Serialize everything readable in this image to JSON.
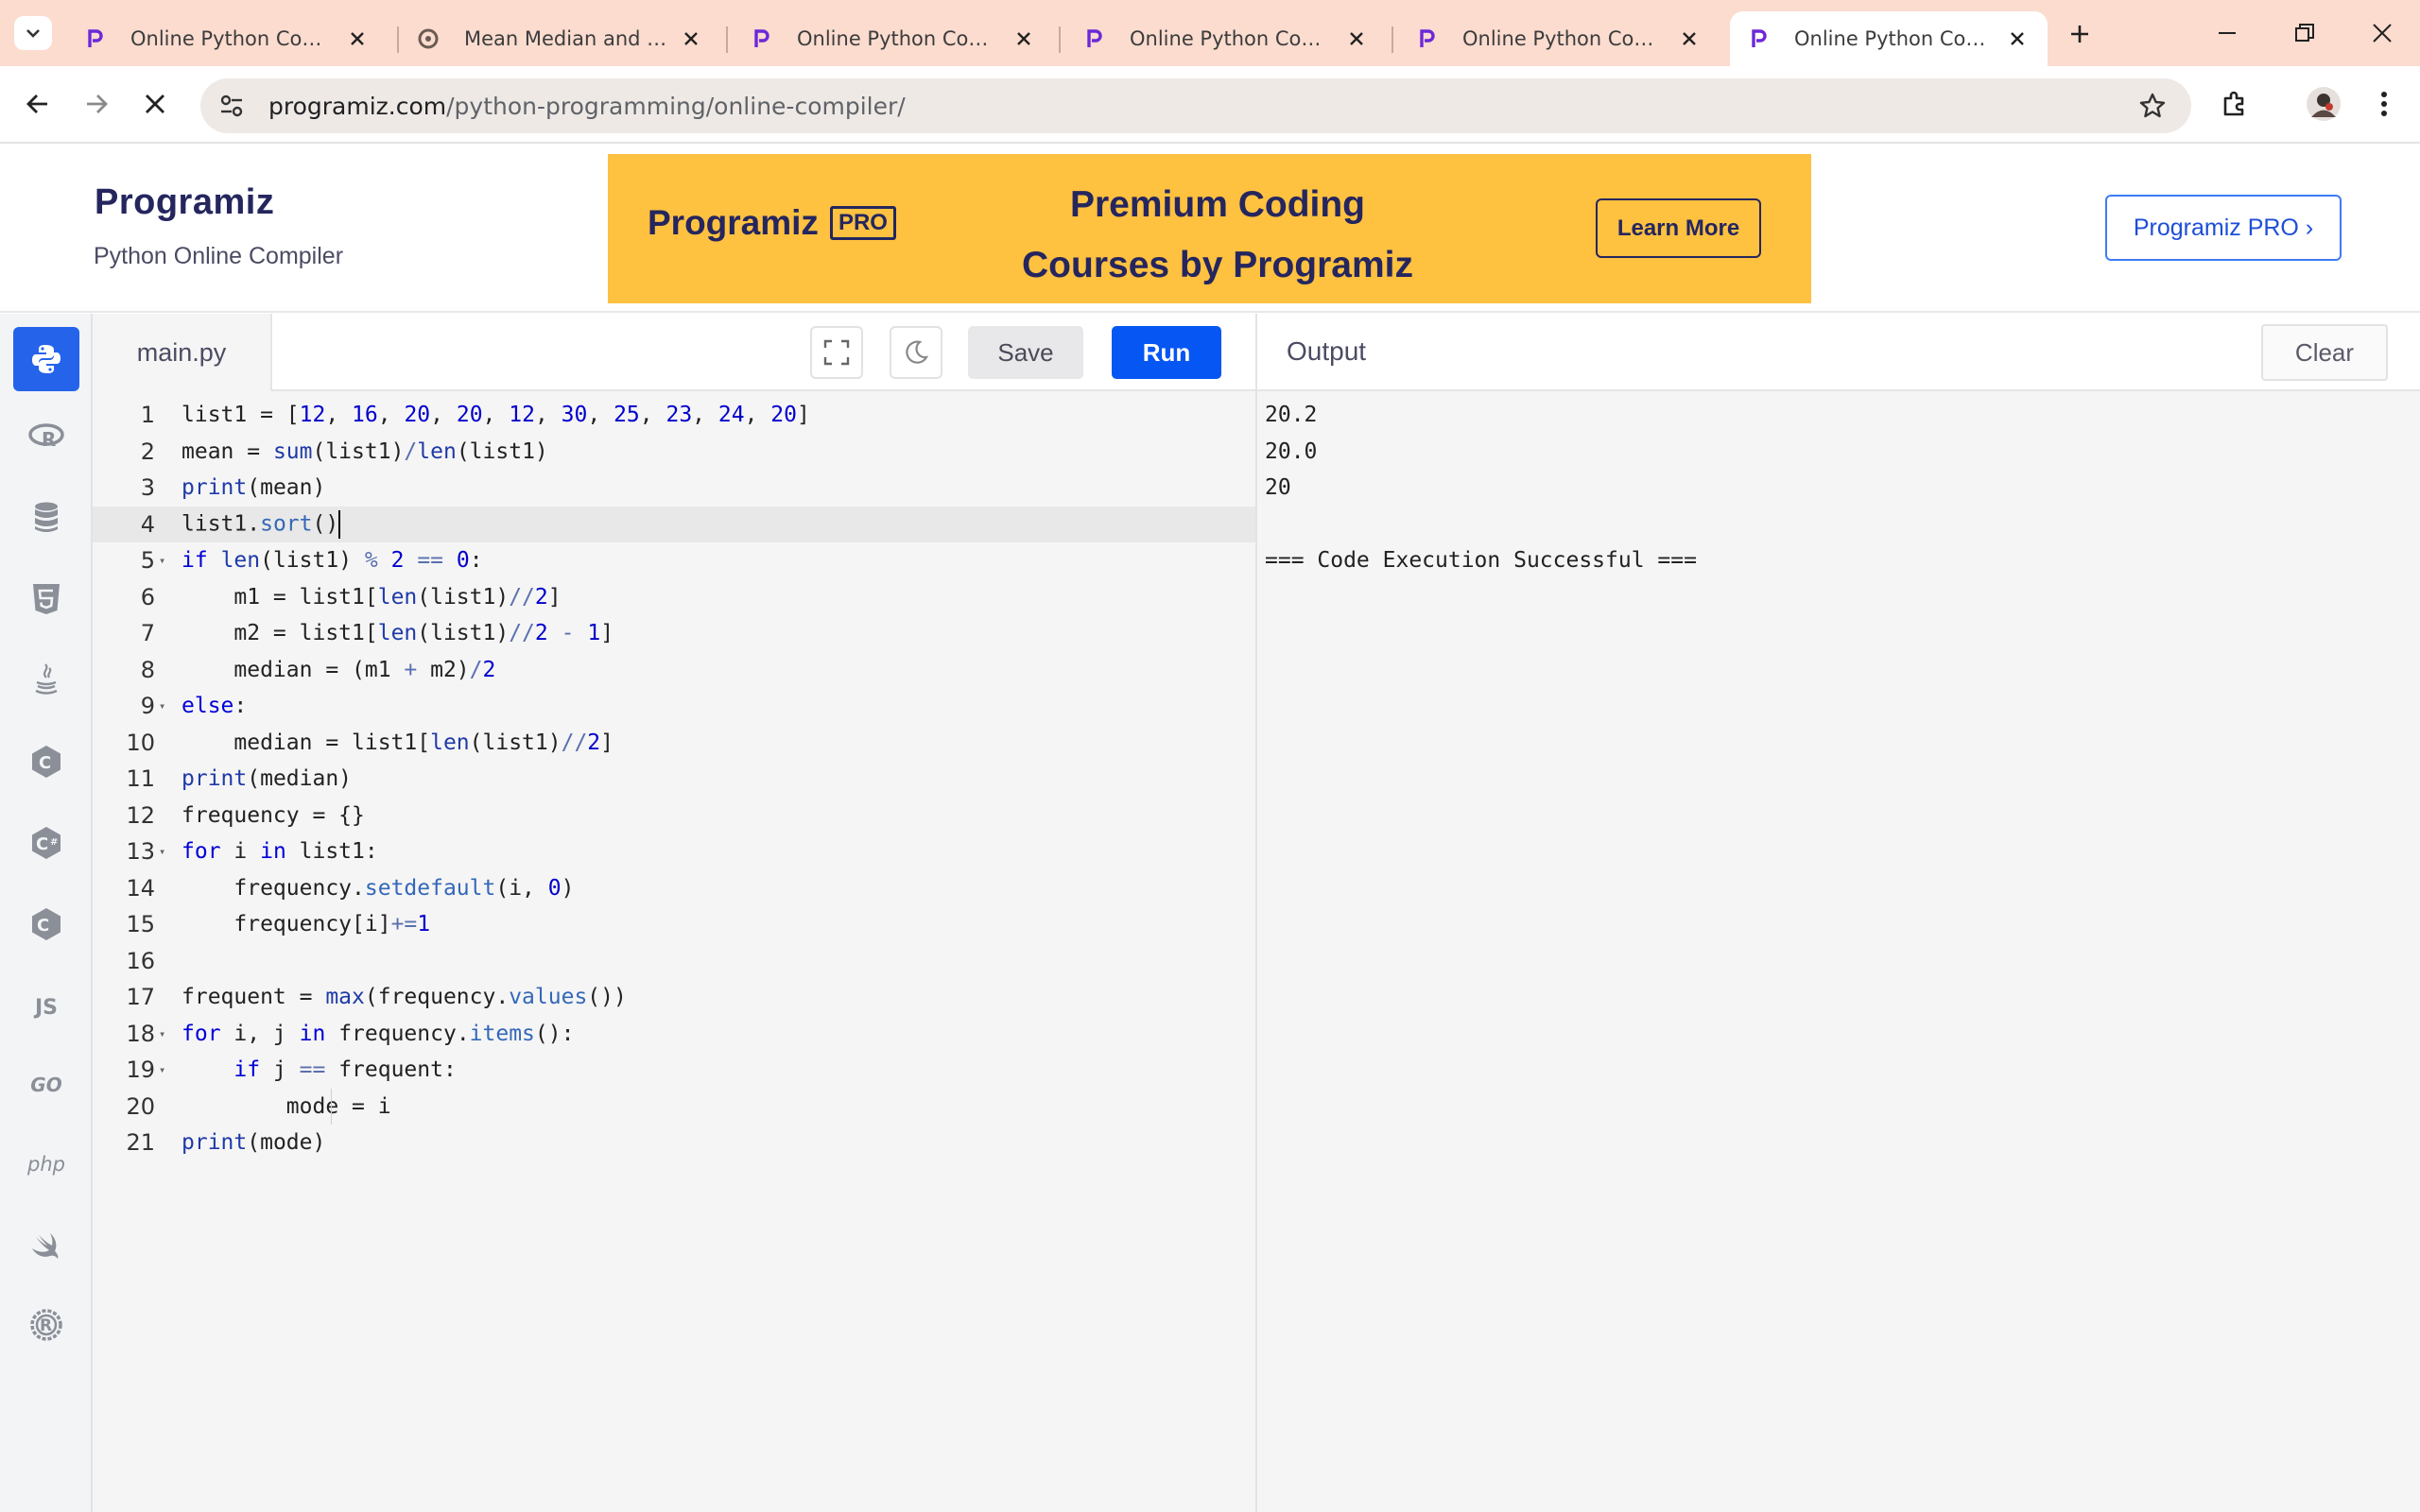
{
  "browser": {
    "tabs": [
      {
        "title": "Online Python Compiler",
        "favicon": "programiz-icon",
        "active": false
      },
      {
        "title": "Mean Median and Mode",
        "favicon": "generic-site-icon",
        "active": false
      },
      {
        "title": "Online Python Compiler",
        "favicon": "programiz-icon",
        "active": false
      },
      {
        "title": "Online Python Compiler",
        "favicon": "programiz-icon",
        "active": false
      },
      {
        "title": "Online Python Compiler",
        "favicon": "programiz-icon",
        "active": false
      },
      {
        "title": "Online Python Compiler",
        "favicon": "programiz-icon",
        "active": true
      }
    ],
    "url_host": "programiz.com",
    "url_path": "/python-programming/online-compiler/"
  },
  "header": {
    "logo": "Programiz",
    "subtitle": "Python Online Compiler",
    "ad": {
      "logo": "Programiz",
      "logo_badge": "PRO",
      "title_line1": "Premium Coding",
      "title_line2": "Courses by Programiz",
      "cta": "Learn More",
      "bg_color": "#fec140"
    },
    "pro_button": "Programiz PRO ›"
  },
  "languages": [
    "python",
    "r",
    "sql",
    "html",
    "java",
    "c",
    "csharp",
    "cpp",
    "js",
    "go",
    "php",
    "swift",
    "rust"
  ],
  "lang_labels": {
    "js": "JS",
    "go": "GO",
    "php": "php"
  },
  "editor": {
    "file_name": "main.py",
    "save_label": "Save",
    "run_label": "Run",
    "run_color": "#0556f3",
    "current_line": 4,
    "lines": [
      "list1 = [12, 16, 20, 20, 12, 30, 25, 23, 24, 20]",
      "mean = sum(list1)/len(list1)",
      "print(mean)",
      "list1.sort()",
      "if len(list1) % 2 == 0:",
      "    m1 = list1[len(list1)//2]",
      "    m2 = list1[len(list1)//2 - 1]",
      "    median = (m1 + m2)/2",
      "else:",
      "    median = list1[len(list1)//2]",
      "print(median)",
      "frequency = {}",
      "for i in list1:",
      "    frequency.setdefault(i, 0)",
      "    frequency[i]+=1",
      "",
      "frequent = max(frequency.values())",
      "for i, j in frequency.items():",
      "    if j == frequent:",
      "        mode = i",
      "print(mode)"
    ],
    "fold_lines": [
      5,
      9,
      13,
      18,
      19
    ]
  },
  "output": {
    "title": "Output",
    "clear_label": "Clear",
    "lines": [
      "20.2",
      "20.0",
      "20",
      "",
      "=== Code Execution Successful ==="
    ]
  }
}
